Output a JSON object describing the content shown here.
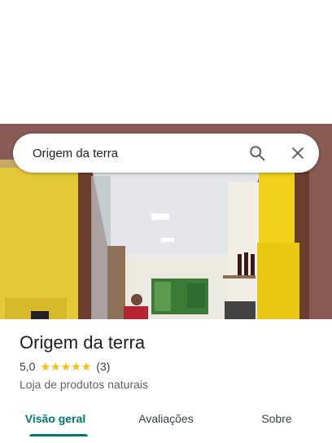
{
  "search": {
    "query": "Origem da terra",
    "search_icon": "search-icon",
    "close_icon": "close-icon"
  },
  "place": {
    "name": "Origem da terra",
    "rating": "5,0",
    "stars": 5,
    "reviews": "(3)",
    "category": "Loja de produtos naturais"
  },
  "tabs": [
    {
      "label": "Visão geral",
      "active": true
    },
    {
      "label": "Avaliações",
      "active": false
    },
    {
      "label": "Sobre",
      "active": false
    }
  ],
  "colors": {
    "accent": "#00796b",
    "star": "#fbbc04"
  }
}
